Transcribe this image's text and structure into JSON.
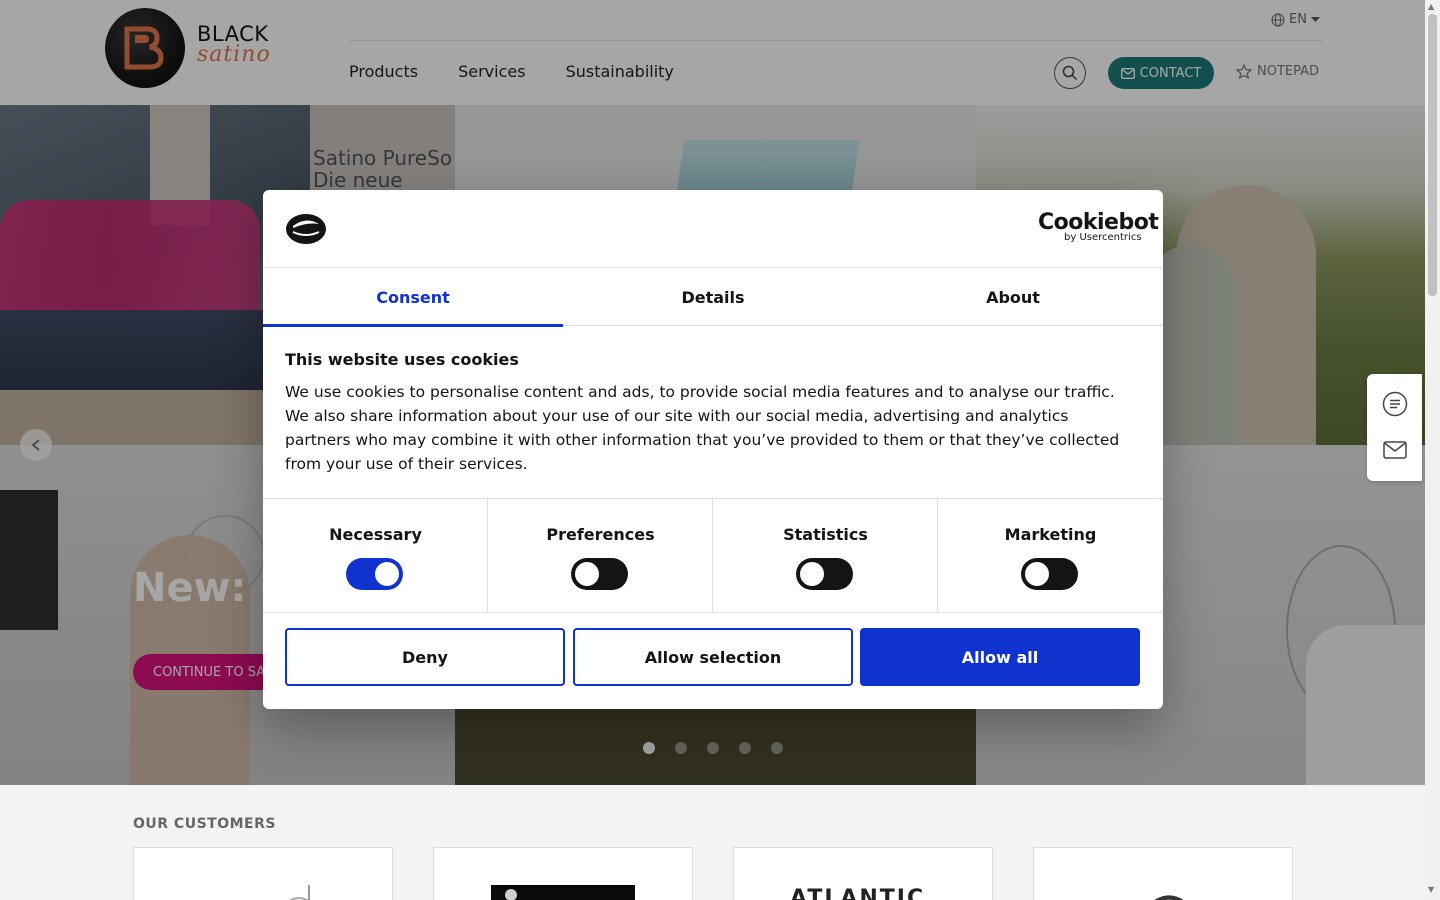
{
  "header": {
    "logo_top": "BLACK",
    "logo_bottom": "satino",
    "language": "EN",
    "nav": [
      "Products",
      "Services",
      "Sustainability"
    ],
    "contact_label": "CONTACT",
    "notepad_label": "NOTEPAD"
  },
  "hero": {
    "sign_line1": "Satino PureSo",
    "sign_line2": "Die neue Gene",
    "title": "New: C",
    "cta_label": "CONTINUE TO SA",
    "slides_total": 5,
    "active_slide": 1
  },
  "customers": {
    "title": "OUR CUSTOMERS",
    "card3_text": "ATLANTIC"
  },
  "cookie_dialog": {
    "brand": "Cookiebot",
    "brand_sub": "by Usercentrics",
    "tabs": [
      "Consent",
      "Details",
      "About"
    ],
    "active_tab": "Consent",
    "heading": "This website uses cookies",
    "body": "We use cookies to personalise content and ads, to provide social media features and to analyse our traffic. We also share information about your use of our site with our social media, advertising and analytics partners who may combine it with other information that you’ve provided to them or that they’ve collected from your use of their services.",
    "categories": [
      {
        "label": "Necessary",
        "enabled": true
      },
      {
        "label": "Preferences",
        "enabled": false
      },
      {
        "label": "Statistics",
        "enabled": false
      },
      {
        "label": "Marketing",
        "enabled": false
      }
    ],
    "buttons": {
      "deny": "Deny",
      "allow_selection": "Allow selection",
      "allow_all": "Allow all"
    }
  },
  "colors": {
    "accent_blue": "#1032cf",
    "contact_teal": "#1e7a78",
    "cta_pink": "#d8127d",
    "logo_orange": "#e0774a"
  }
}
